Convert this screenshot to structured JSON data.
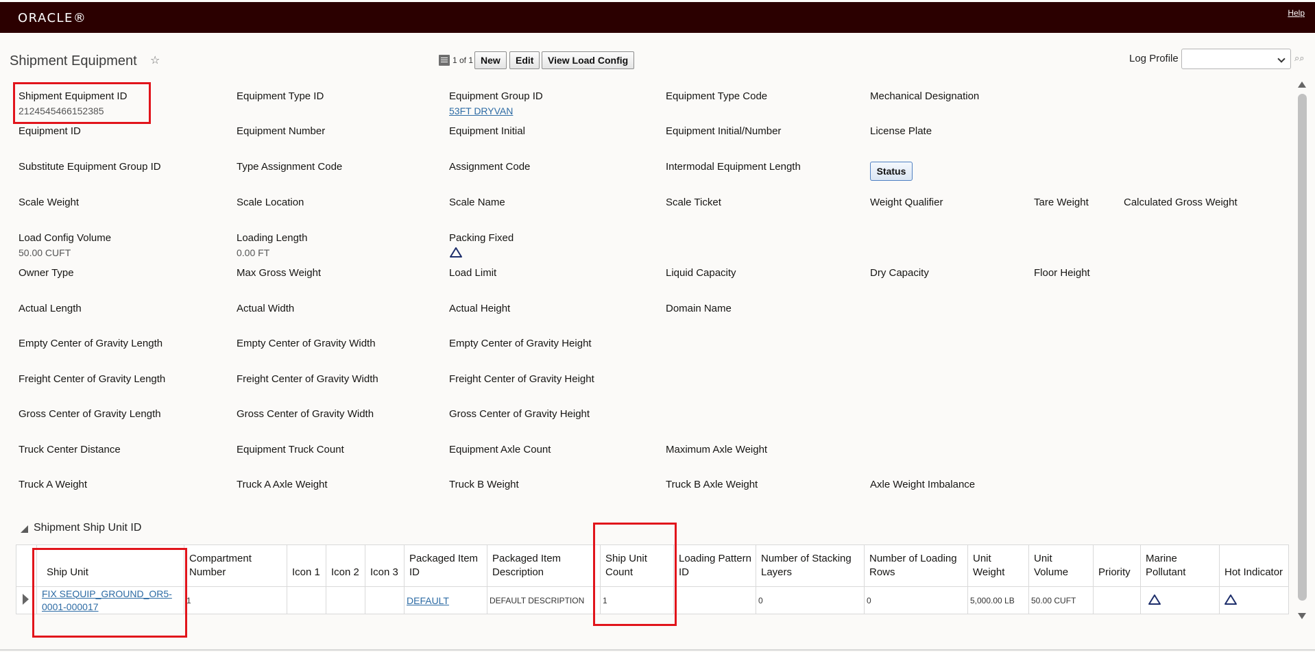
{
  "header": {
    "logo": "ORACLE®",
    "help": "Help"
  },
  "page": {
    "title": "Shipment Equipment"
  },
  "pager": {
    "text": "1 of 1"
  },
  "toolbar": {
    "new_label": "New",
    "edit_label": "Edit",
    "view_load_config_label": "View Load Config"
  },
  "log_profile": {
    "label": "Log Profile",
    "value": ""
  },
  "fields": {
    "shipment_equipment_id": {
      "label": "Shipment Equipment ID",
      "value": "2124545466152385"
    },
    "equipment_type_id": {
      "label": "Equipment Type ID"
    },
    "equipment_group_id": {
      "label": "Equipment Group ID",
      "value": "53FT DRYVAN"
    },
    "equipment_type_code": {
      "label": "Equipment Type Code"
    },
    "mechanical_designation": {
      "label": "Mechanical Designation"
    },
    "equipment_id": {
      "label": "Equipment ID"
    },
    "equipment_number": {
      "label": "Equipment Number"
    },
    "equipment_initial": {
      "label": "Equipment Initial"
    },
    "equipment_initial_number": {
      "label": "Equipment Initial/Number"
    },
    "license_plate": {
      "label": "License Plate"
    },
    "substitute_equipment_group_id": {
      "label": "Substitute Equipment Group ID"
    },
    "type_assignment_code": {
      "label": "Type Assignment Code"
    },
    "assignment_code": {
      "label": "Assignment Code"
    },
    "intermodal_equipment_length": {
      "label": "Intermodal Equipment Length"
    },
    "status_button": {
      "label": "Status"
    },
    "scale_weight": {
      "label": "Scale Weight"
    },
    "scale_location": {
      "label": "Scale Location"
    },
    "scale_name": {
      "label": "Scale Name"
    },
    "scale_ticket": {
      "label": "Scale Ticket"
    },
    "weight_qualifier": {
      "label": "Weight Qualifier"
    },
    "tare_weight": {
      "label": "Tare Weight"
    },
    "calculated_gross_weight": {
      "label": "Calculated Gross Weight"
    },
    "load_config_volume": {
      "label": "Load Config Volume",
      "value": "50.00 CUFT"
    },
    "loading_length": {
      "label": "Loading Length",
      "value": "0.00 FT"
    },
    "packing_fixed": {
      "label": "Packing Fixed",
      "icon": "triangle-outline-icon"
    },
    "owner_type": {
      "label": "Owner Type"
    },
    "max_gross_weight": {
      "label": "Max Gross Weight"
    },
    "load_limit": {
      "label": "Load Limit"
    },
    "liquid_capacity": {
      "label": "Liquid Capacity"
    },
    "dry_capacity": {
      "label": "Dry Capacity"
    },
    "floor_height": {
      "label": "Floor Height"
    },
    "actual_length": {
      "label": "Actual Length"
    },
    "actual_width": {
      "label": "Actual Width"
    },
    "actual_height": {
      "label": "Actual Height"
    },
    "domain_name": {
      "label": "Domain Name"
    },
    "empty_cog_length": {
      "label": "Empty Center of Gravity Length"
    },
    "empty_cog_width": {
      "label": "Empty Center of Gravity Width"
    },
    "empty_cog_height": {
      "label": "Empty Center of Gravity Height"
    },
    "freight_cog_length": {
      "label": "Freight Center of Gravity Length"
    },
    "freight_cog_width": {
      "label": "Freight Center of Gravity Width"
    },
    "freight_cog_height": {
      "label": "Freight Center of Gravity Height"
    },
    "gross_cog_length": {
      "label": "Gross Center of Gravity Length"
    },
    "gross_cog_width": {
      "label": "Gross Center of Gravity Width"
    },
    "gross_cog_height": {
      "label": "Gross Center of Gravity Height"
    },
    "truck_center_distance": {
      "label": "Truck Center Distance"
    },
    "equipment_truck_count": {
      "label": "Equipment Truck Count"
    },
    "equipment_axle_count": {
      "label": "Equipment Axle Count"
    },
    "maximum_axle_weight": {
      "label": "Maximum Axle Weight"
    },
    "truck_a_weight": {
      "label": "Truck A Weight"
    },
    "truck_a_axle_weight": {
      "label": "Truck A Axle Weight"
    },
    "truck_b_weight": {
      "label": "Truck B Weight"
    },
    "truck_b_axle_weight": {
      "label": "Truck B Axle Weight"
    },
    "axle_weight_imbalance": {
      "label": "Axle Weight Imbalance"
    }
  },
  "ship_unit_section": {
    "title": "Shipment Ship Unit ID",
    "columns": [
      "Ship Unit",
      "Compartment Number",
      "Icon 1",
      "Icon 2",
      "Icon 3",
      "Packaged Item ID",
      "Packaged Item Description",
      "Ship Unit Count",
      "Loading Pattern ID",
      "Number of Stacking Layers",
      "Number of Loading Rows",
      "Unit Weight",
      "Unit Volume",
      "Priority",
      "Marine Pollutant",
      "Hot Indicator"
    ],
    "rows": [
      {
        "ship_unit": "FIX SEQUIP_GROUND_OR5-0001-000017",
        "compartment_number": "1",
        "icon1": "",
        "icon2": "",
        "icon3": "",
        "packaged_item_id": "DEFAULT",
        "packaged_item_description": "DEFAULT DESCRIPTION",
        "ship_unit_count": "1",
        "loading_pattern_id": "",
        "stacking_layers": "0",
        "loading_rows": "0",
        "unit_weight": "5,000.00 LB",
        "unit_volume": "50.00 CUFT",
        "priority": "",
        "marine_pollutant_icon": "triangle-outline-icon",
        "hot_indicator_icon": "triangle-outline-icon"
      }
    ]
  },
  "colors": {
    "topbar": "#2b0000",
    "highlight": "#e1141b",
    "link": "#2d6ba4",
    "triangle_icon": "#1d2e6b"
  }
}
